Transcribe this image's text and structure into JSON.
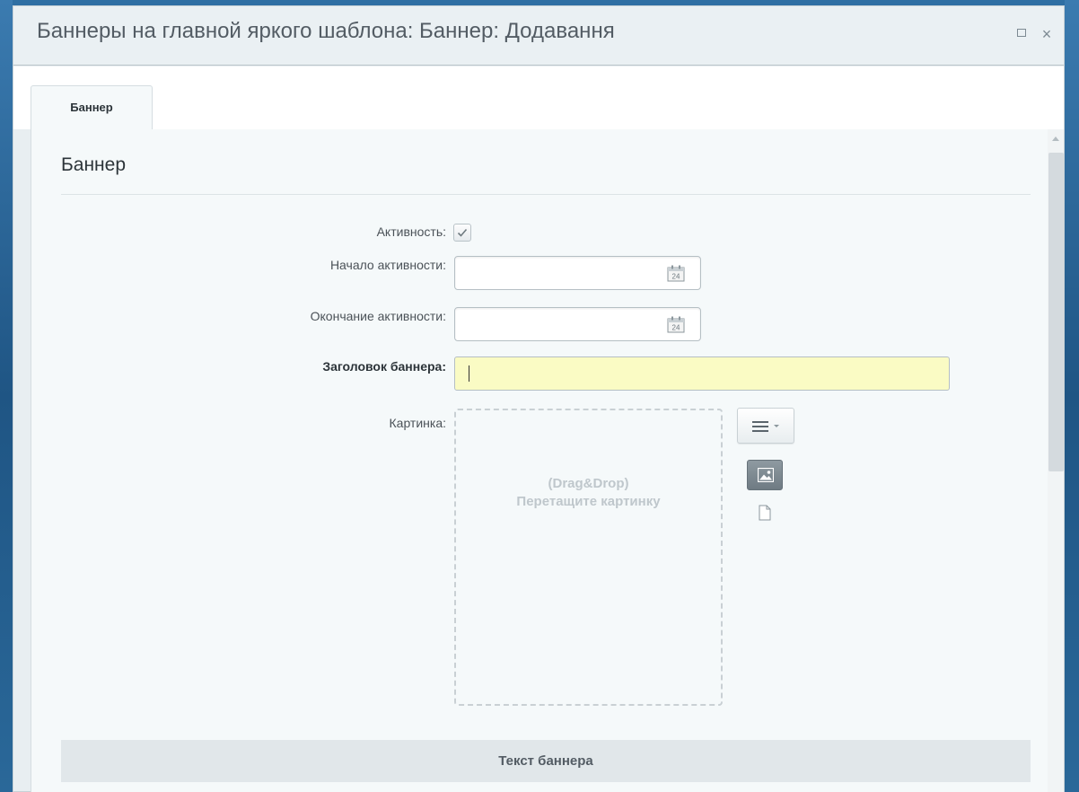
{
  "window": {
    "title": "Баннеры на главной яркого шаблона: Баннер: Додавання",
    "maximize_icon": "maximize-icon",
    "close_icon": "close-icon"
  },
  "tabs": [
    {
      "label": "Баннер",
      "active": true
    }
  ],
  "section": {
    "title": "Баннер"
  },
  "form": {
    "active": {
      "label": "Активность:",
      "checked": true
    },
    "start_date": {
      "label": "Начало активности:",
      "value": "",
      "icon": "calendar-icon"
    },
    "end_date": {
      "label": "Окончание активности:",
      "value": "",
      "icon": "calendar-icon"
    },
    "banner_title": {
      "label": "Заголовок баннера:",
      "value": "",
      "required": true,
      "highlight_color": "#fafbc4"
    },
    "picture": {
      "label": "Картинка:",
      "dropzone_line1": "(Drag&Drop)",
      "dropzone_line2": "Перетащите картинку"
    }
  },
  "text_section": {
    "label": "Текст баннера"
  },
  "colors": {
    "desktop_bg": "#2e6a9a",
    "dialog_bg": "#e8eef1",
    "content_bg": "#f5f9fa"
  }
}
